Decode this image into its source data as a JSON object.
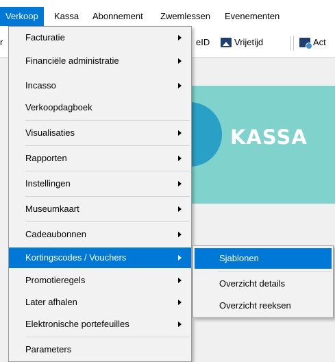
{
  "menubar": {
    "items": [
      {
        "label": "Verkoop",
        "active": true
      },
      {
        "label": "Kassa"
      },
      {
        "label": "Abonnement"
      },
      {
        "label": "Zwemlessen"
      },
      {
        "label": "Evenementen"
      }
    ]
  },
  "toolbar": {
    "left_fragment": "r",
    "eid_label": "eID",
    "vrijetijd_label": "Vrijetijd",
    "act_label": "Act"
  },
  "tile": {
    "label": "KASSA",
    "colors": {
      "background": "#7fd3cc",
      "circle": "#2aa0c6",
      "text": "#ffffff"
    }
  },
  "main_menu": {
    "items": [
      {
        "label": "Facturatie",
        "submenu": true
      },
      {
        "label": "Financiële administratie",
        "submenu": true
      },
      {
        "label": "Incasso",
        "submenu": true
      },
      {
        "label": "Verkoopdagboek",
        "submenu": false
      },
      {
        "label": "Visualisaties",
        "submenu": true
      },
      {
        "label": "Rapporten",
        "submenu": true
      },
      {
        "label": "Instellingen",
        "submenu": true
      },
      {
        "label": "Museumkaart",
        "submenu": true
      },
      {
        "label": "Cadeaubonnen",
        "submenu": true
      },
      {
        "label": "Kortingscodes / Vouchers",
        "submenu": true,
        "selected": true
      },
      {
        "label": "Promotieregels",
        "submenu": true
      },
      {
        "label": "Later afhalen",
        "submenu": true
      },
      {
        "label": "Elektronische portefeuilles",
        "submenu": true
      },
      {
        "label": "Parameters",
        "submenu": false
      }
    ]
  },
  "sub_menu": {
    "items": [
      {
        "label": "Sjablonen",
        "selected": true
      },
      {
        "label": "Overzicht details"
      },
      {
        "label": "Overzicht reeksen"
      }
    ]
  },
  "colors": {
    "accent": "#0078d7",
    "menu_bg": "#f2f2f2"
  }
}
